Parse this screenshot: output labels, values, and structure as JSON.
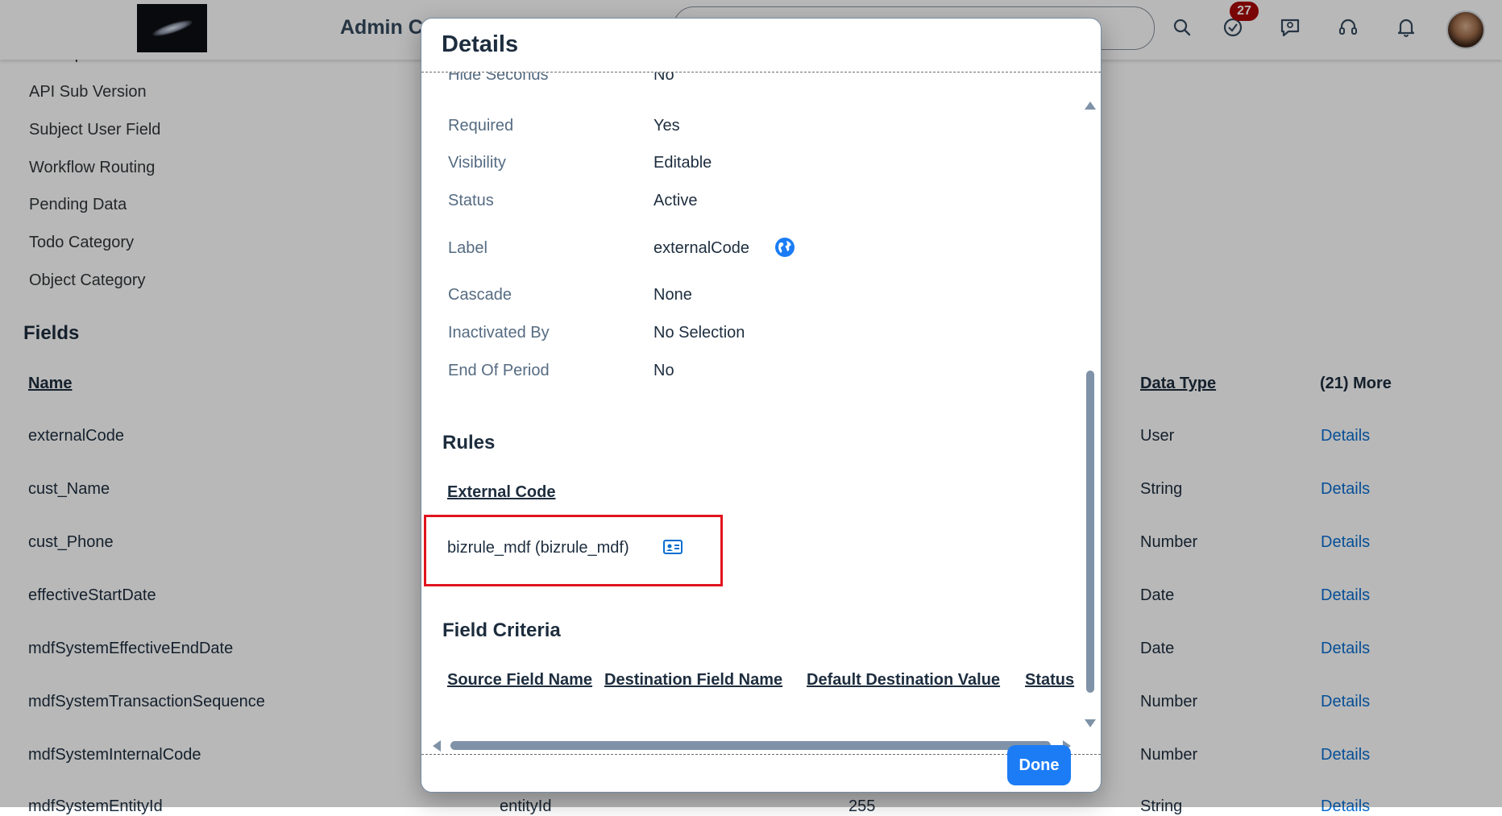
{
  "shell": {
    "app_title": "Admin C",
    "notification_count": "27",
    "icons": [
      "search-icon",
      "tasks-icon",
      "feedback-icon",
      "headset-icon",
      "bell-icon"
    ]
  },
  "sidebar": {
    "items": [
      {
        "label": "Description"
      },
      {
        "label": "API Sub Version"
      },
      {
        "label": "Subject User Field"
      },
      {
        "label": "Workflow Routing"
      },
      {
        "label": "Pending Data"
      },
      {
        "label": "Todo Category"
      },
      {
        "label": "Object Category"
      }
    ]
  },
  "fields_section": {
    "title": "Fields",
    "columns": {
      "name": "Name",
      "data_type": "Data Type",
      "more": "(21) More"
    },
    "rows": [
      {
        "name": "externalCode",
        "type": "User",
        "link": "Details"
      },
      {
        "name": "cust_Name",
        "type": "String",
        "link": "Details"
      },
      {
        "name": "cust_Phone",
        "type": "Number",
        "link": "Details"
      },
      {
        "name": "effectiveStartDate",
        "type": "Date",
        "link": "Details"
      },
      {
        "name": "mdfSystemEffectiveEndDate",
        "type": "Date",
        "link": "Details"
      },
      {
        "name": "mdfSystemTransactionSequence",
        "type": "Number",
        "link": "Details"
      },
      {
        "name": "mdfSystemInternalCode",
        "type": "Number",
        "link": "Details"
      },
      {
        "name": "mdfSystemEntityId",
        "type": "String",
        "link": "Details",
        "extra_1": "entityId",
        "extra_2": "255"
      }
    ]
  },
  "dialog": {
    "title": "Details",
    "properties": [
      {
        "label": "Hide Seconds",
        "value": "No"
      },
      {
        "label": "Required",
        "value": "Yes"
      },
      {
        "label": "Visibility",
        "value": "Editable"
      },
      {
        "label": "Status",
        "value": "Active"
      },
      {
        "label": "Label",
        "value": "externalCode"
      },
      {
        "label": "Cascade",
        "value": "None"
      },
      {
        "label": "Inactivated By",
        "value": "No Selection"
      },
      {
        "label": "End Of Period",
        "value": "No"
      }
    ],
    "rules": {
      "title": "Rules",
      "column": "External Code",
      "rule": "bizrule_mdf (bizrule_mdf)"
    },
    "field_criteria": {
      "title": "Field Criteria",
      "columns": [
        "Source Field Name",
        "Destination Field Name",
        "Default Destination Value",
        "Status"
      ]
    },
    "done_label": "Done"
  },
  "colors": {
    "accent": "#1b7cf5",
    "link": "#0a6ed1",
    "highlight_box": "#e1141e",
    "badge": "#aa0808"
  }
}
